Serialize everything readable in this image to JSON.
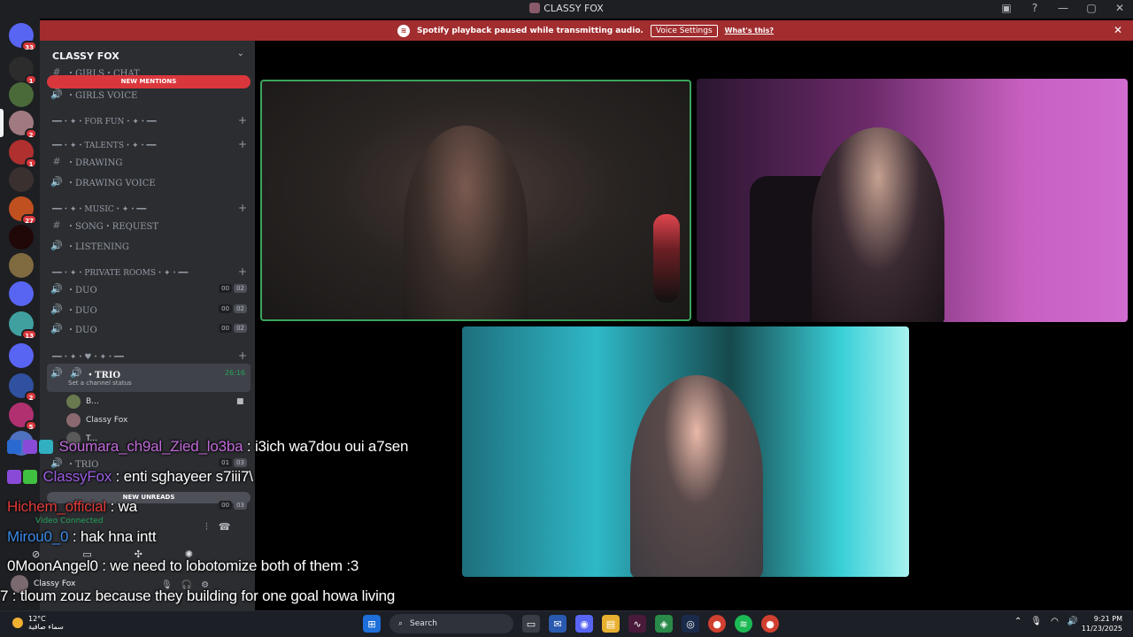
{
  "window": {
    "title": "CLASSY FOX"
  },
  "banner": {
    "text": "Spotify playback paused while transmitting audio.",
    "button": "Voice Settings",
    "link": "What's this?"
  },
  "guilds": [
    {
      "badge": "33",
      "color": "#5865f2"
    },
    {
      "badge": "1",
      "color": "#2c2c2c"
    },
    {
      "badge": "",
      "color": "#4a6a3a"
    },
    {
      "badge": "2",
      "color": "#a07a80"
    },
    {
      "badge": "1",
      "color": "#b03030"
    },
    {
      "badge": "",
      "color": "#3a3030"
    },
    {
      "badge": "27",
      "color": "#c05020"
    },
    {
      "badge": "",
      "color": "#200808"
    },
    {
      "badge": "",
      "color": "#806a40"
    },
    {
      "badge": "",
      "color": "#5865f2"
    },
    {
      "badge": "13",
      "color": "#40a0a0"
    },
    {
      "badge": "",
      "color": "#5865f2"
    },
    {
      "badge": "2",
      "color": "#3050a0"
    },
    {
      "badge": "5",
      "color": "#b03070"
    },
    {
      "badge": "",
      "color": "#5070c0"
    }
  ],
  "sidebar": {
    "server_name": "CLASSY FOX",
    "new_mentions": "NEW MENTIONS",
    "new_unreads": "NEW UNREADS",
    "channels": {
      "girls_chat": "・GIRLS・CHAT",
      "girls_voice": "・GIRLS VOICE",
      "cat_for_fun": "━━・✦・FOR FUN・✦・━━",
      "cat_talents": "━━・✦・TALENTS・✦・━━",
      "drawing": "・DRAWING",
      "drawing_voice": "・DRAWING VOICE",
      "cat_music": "━━・✦・MUSIC・✦・━━",
      "song_request": "・SONG・REQUEST",
      "listening": "・LISTENING",
      "cat_private": "━━・✦・PRIVATE ROOMS・✦・━━",
      "duo": "・DUO",
      "cat_heart": "━━・✦・♥・✦・━━",
      "trio": "・TRIO",
      "trio_status": "Set a channel status",
      "trio_timer": "26:16",
      "trio2": "・TRIO"
    },
    "duo_counts": [
      "00",
      "02"
    ],
    "trio_counts": [
      "01",
      "03"
    ],
    "bottom_counts": [
      "00",
      "03"
    ],
    "voice_users": [
      "B...",
      "Classy Fox",
      "T..."
    ]
  },
  "voice_panel": {
    "status": "Video Connected",
    "user": "Classy Fox"
  },
  "chat_overlay": [
    {
      "name": "Soumara_ch9al_Zied_lo3ba",
      "text": ": i3ich wa7dou oui a7sen",
      "color": "#c06ad8"
    },
    {
      "name": "ClassyFox",
      "text": ": enti sghayeer s7iii7\\",
      "color": "#9a5ce0"
    },
    {
      "name": "Hichem_official",
      "text": ": wa",
      "color": "#e03a3a"
    },
    {
      "name": "Mirou0_0",
      "text": ": hak hna intt",
      "color": "#3a8ae8"
    },
    {
      "name": "0MoonAngel0",
      "text": ": we need to lobotomize both of them :3",
      "color": "#ffffff"
    },
    {
      "name": "7",
      "text": ": tloum zouz because they building for one goal howa living",
      "color": "#ffffff"
    }
  ],
  "taskbar": {
    "temp": "12°C",
    "weather": "سماء صافية",
    "search": "Search",
    "time": "9:21 PM",
    "date": "11/23/2025"
  }
}
